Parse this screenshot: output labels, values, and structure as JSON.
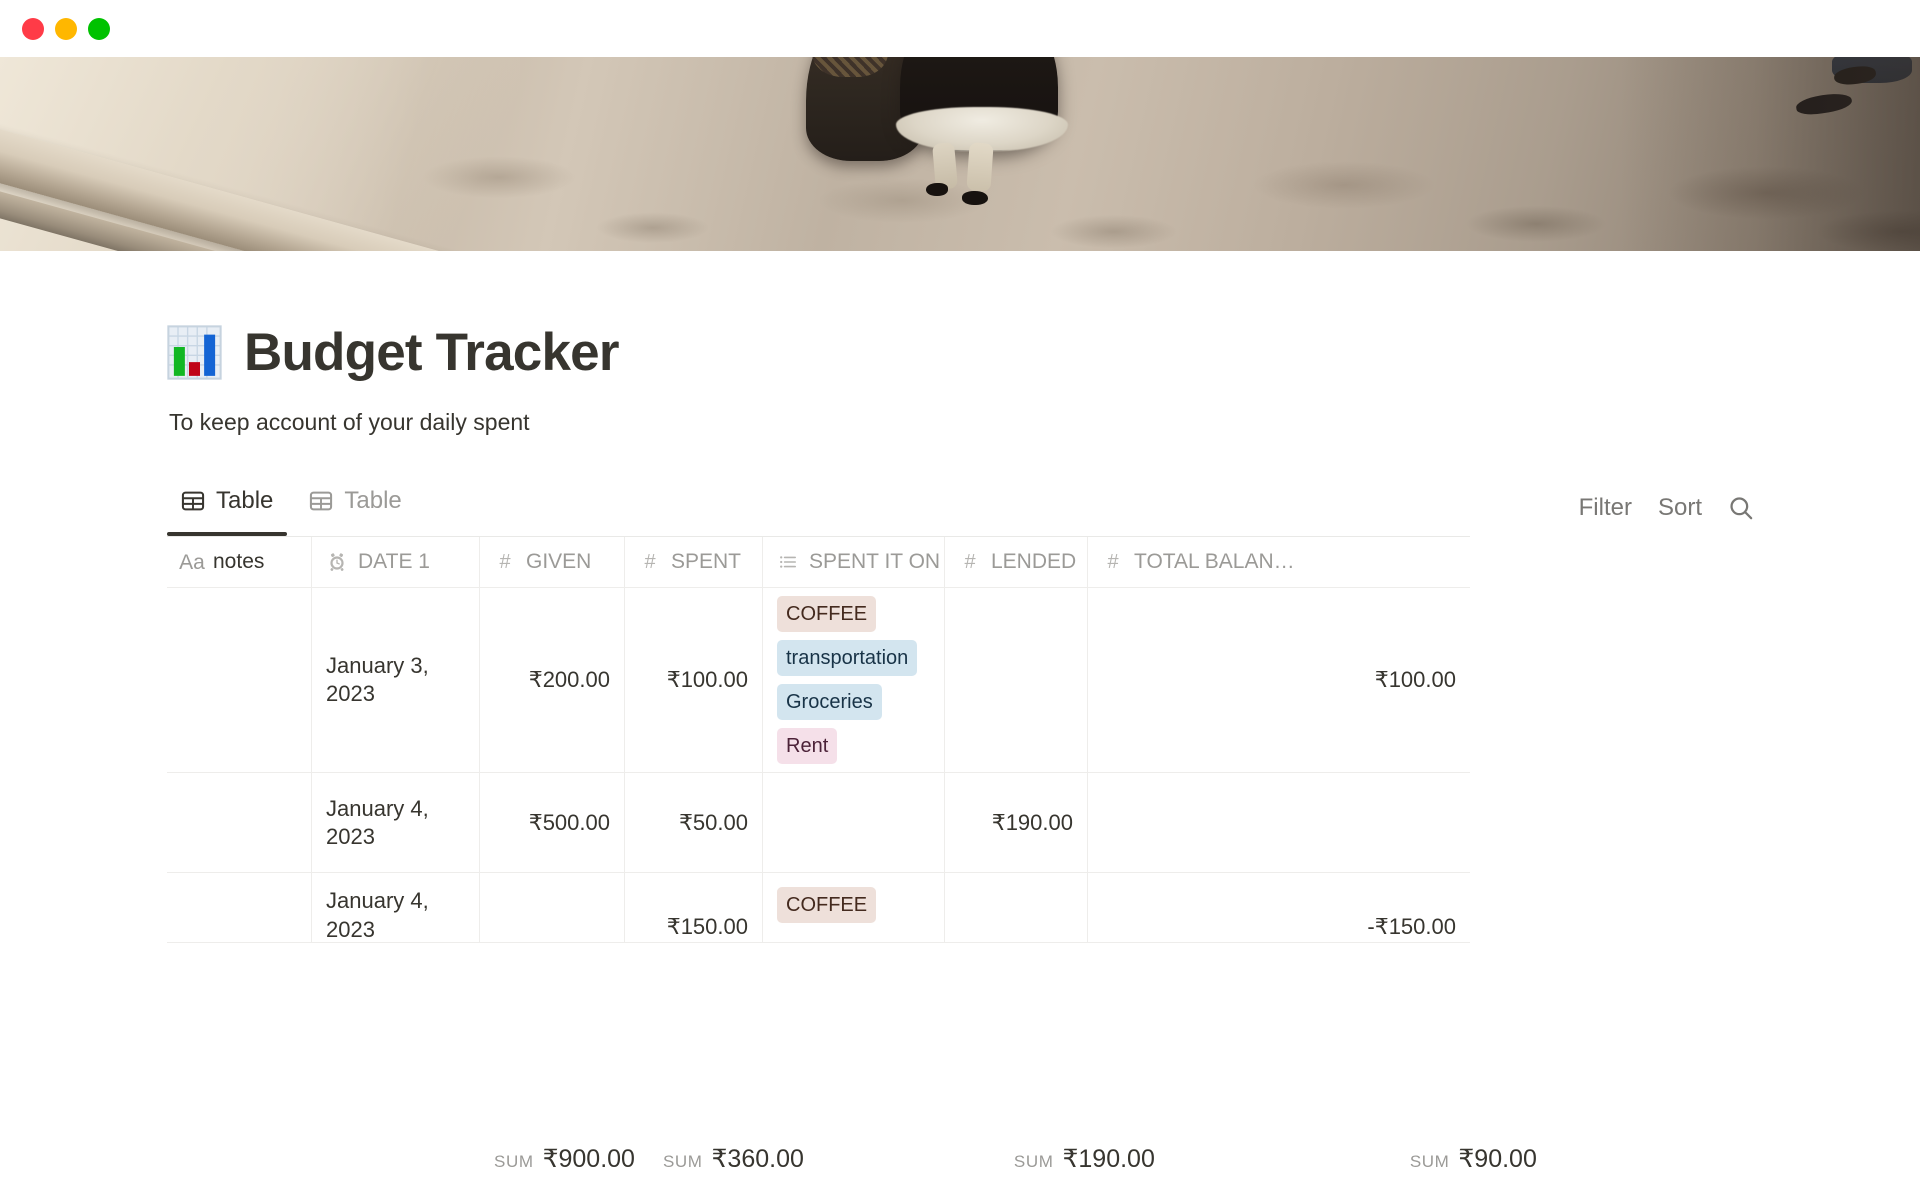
{
  "window": {
    "traffic_lights": [
      {
        "name": "close",
        "color": "#ff3b47"
      },
      {
        "name": "minimize",
        "color": "#ffb700"
      },
      {
        "name": "maximize",
        "color": "#00c200"
      }
    ]
  },
  "cover": {
    "alt": "painting of figures walking on a cobblestone street"
  },
  "page": {
    "emoji": "bar-chart-emoji",
    "title": "Budget Tracker",
    "subtitle": "To keep account of your daily spent"
  },
  "views": {
    "tabs": [
      {
        "label": "Table",
        "icon": "table-icon",
        "active": true
      },
      {
        "label": "Table",
        "icon": "table-icon",
        "active": false
      }
    ],
    "tools": {
      "filter_label": "Filter",
      "sort_label": "Sort",
      "search_icon": "search-icon"
    }
  },
  "table": {
    "columns": [
      {
        "key": "notes",
        "label": "notes",
        "icon": "Aa",
        "type": "title"
      },
      {
        "key": "date",
        "label": "DATE 1",
        "icon": "clock",
        "type": "date"
      },
      {
        "key": "given",
        "label": "GIVEN",
        "icon": "#",
        "type": "number"
      },
      {
        "key": "spent",
        "label": "SPENT",
        "icon": "#",
        "type": "number"
      },
      {
        "key": "tags",
        "label": "SPENT IT ON",
        "icon": "list",
        "type": "multi-select"
      },
      {
        "key": "lended",
        "label": "LENDED",
        "icon": "#",
        "type": "number"
      },
      {
        "key": "total",
        "label": "TOTAL BALAN…",
        "icon": "#",
        "type": "number"
      }
    ],
    "rows": [
      {
        "notes": "",
        "date": "January 3, 2023",
        "given": "₹200.00",
        "spent": "₹100.00",
        "tags": [
          {
            "label": "COFFEE",
            "bg": "#eee0da",
            "fg": "#442a1e"
          },
          {
            "label": "transportation",
            "bg": "#d3e5ef",
            "fg": "#183347"
          },
          {
            "label": "Groceries",
            "bg": "#d3e5ef",
            "fg": "#183347"
          },
          {
            "label": "Rent",
            "bg": "#f5e0e9",
            "fg": "#4c2238"
          }
        ],
        "lended": "",
        "total": "₹100.00"
      },
      {
        "notes": "",
        "date": "January 4, 2023",
        "given": "₹500.00",
        "spent": "₹50.00",
        "tags": [],
        "lended": "₹190.00",
        "total": ""
      },
      {
        "notes": "",
        "date": "January 4, 2023",
        "given": "",
        "spent": "₹150.00",
        "tags": [
          {
            "label": "COFFEE",
            "bg": "#eee0da",
            "fg": "#442a1e"
          }
        ],
        "lended": "",
        "total": "-₹150.00"
      }
    ],
    "summary": {
      "label": "SUM",
      "given": "₹900.00",
      "spent": "₹360.00",
      "lended": "₹190.00",
      "total": "₹90.00"
    }
  }
}
